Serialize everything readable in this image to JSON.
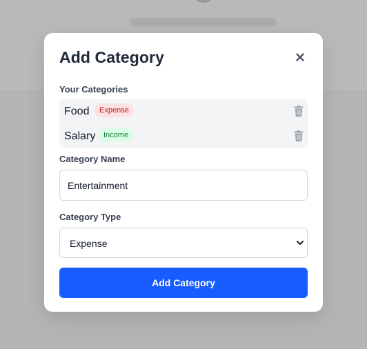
{
  "modal": {
    "title": "Add Category",
    "close_icon": "close-icon"
  },
  "categories_section": {
    "label": "Your Categories",
    "items": [
      {
        "name": "Food",
        "type": "Expense",
        "delete_icon": "trash-icon"
      },
      {
        "name": "Salary",
        "type": "Income",
        "delete_icon": "trash-icon"
      }
    ]
  },
  "name_field": {
    "label": "Category Name",
    "value": "Entertainment"
  },
  "type_field": {
    "label": "Category Type",
    "selected": "Expense",
    "chevron_icon": "chevron-down-icon"
  },
  "submit": {
    "label": "Add Category"
  },
  "colors": {
    "primary": "#175cff",
    "expense_badge_bg": "#fee2e2",
    "expense_badge_text": "#b91c1c",
    "income_badge_bg": "#dcfce7",
    "income_badge_text": "#15803d"
  }
}
